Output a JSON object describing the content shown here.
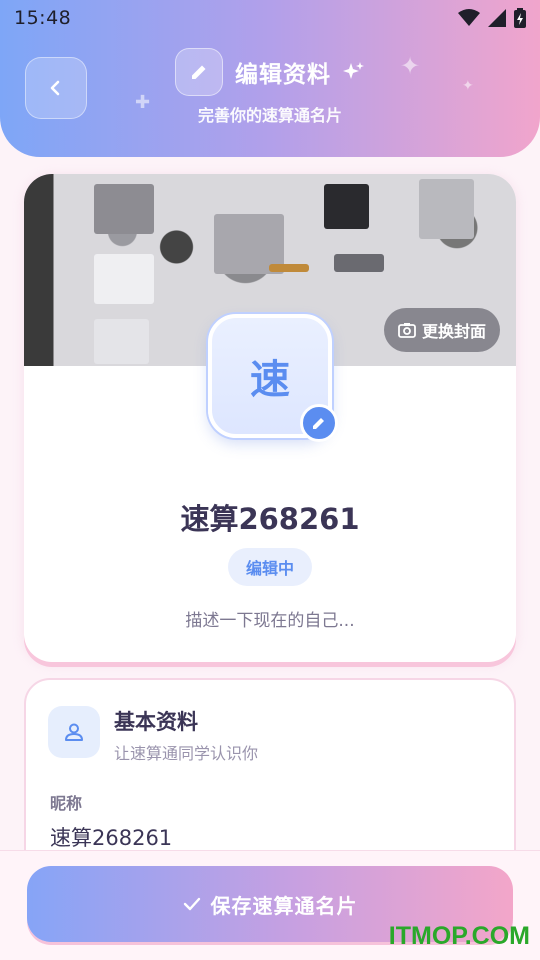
{
  "status_bar": {
    "time": "15:48"
  },
  "header": {
    "title": "编辑资料",
    "subtitle": "完善你的速算通名片",
    "back_icon": "chevron-left-icon",
    "title_icon": "pencil-icon"
  },
  "profile": {
    "cover_button_label": "更换封面",
    "avatar_char": "速",
    "username": "速算268261",
    "status": "编辑中",
    "bio_placeholder": "描述一下现在的自己..."
  },
  "basic_info": {
    "title": "基本资料",
    "subtitle": "让速算通同学认识你",
    "nickname_label": "昵称",
    "nickname_value": "速算268261"
  },
  "save_button_label": "保存速算通名片",
  "watermark": "ITMOP.COM",
  "colors": {
    "accent_blue": "#5b8df0",
    "gradient_start": "#7ea6f7",
    "gradient_end": "#f1a5cc",
    "watermark_green": "#2aa82a"
  }
}
